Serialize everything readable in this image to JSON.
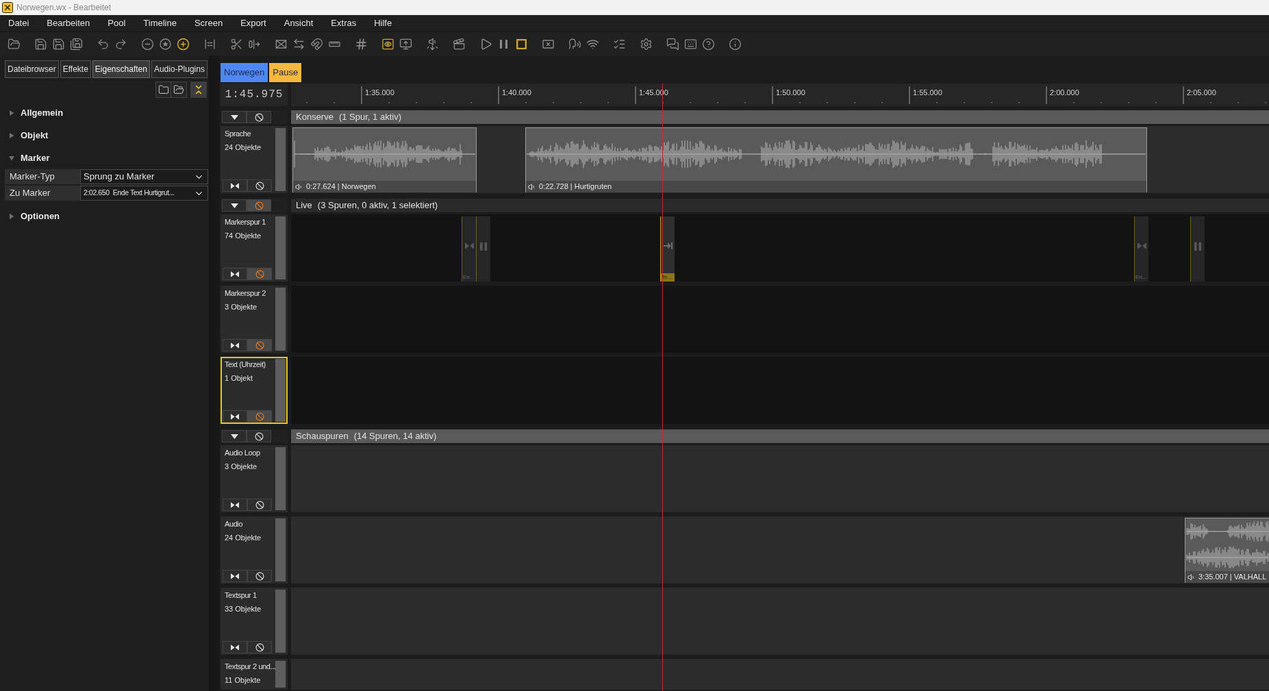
{
  "window": {
    "title": "Norwegen.wx - Bearbeitet"
  },
  "menu": [
    "Datei",
    "Bearbeiten",
    "Pool",
    "Timeline",
    "Screen",
    "Export",
    "Ansicht",
    "Extras",
    "Hilfe"
  ],
  "toolbar": {
    "groups": [
      {
        "buttons": [
          {
            "kind": "open",
            "on": false
          }
        ]
      },
      {
        "buttons": [
          {
            "kind": "save",
            "on": false
          },
          {
            "kind": "saveas",
            "on": false
          },
          {
            "kind": "saveplus",
            "on": false
          }
        ]
      },
      {
        "buttons": [
          {
            "kind": "undo",
            "on": false
          },
          {
            "kind": "redo",
            "on": false
          }
        ]
      },
      {
        "buttons": [
          {
            "kind": "zoomout",
            "on": false
          },
          {
            "kind": "zoomstar",
            "on": false
          },
          {
            "kind": "zoomin",
            "on": true
          }
        ]
      },
      {
        "buttons": [
          {
            "kind": "columns",
            "on": false
          }
        ]
      },
      {
        "buttons": [
          {
            "kind": "cut",
            "on": false
          },
          {
            "kind": "split",
            "on": false
          }
        ]
      },
      {
        "buttons": [
          {
            "kind": "crossfade",
            "on": false
          },
          {
            "kind": "swap",
            "on": false
          },
          {
            "kind": "magnet",
            "on": false
          },
          {
            "kind": "ruler",
            "on": false
          }
        ]
      },
      {
        "buttons": [
          {
            "kind": "grid",
            "on": false
          }
        ]
      },
      {
        "buttons": [
          {
            "kind": "preview",
            "on": true
          },
          {
            "kind": "screen",
            "on": false
          }
        ]
      },
      {
        "buttons": [
          {
            "kind": "audio",
            "on": false
          }
        ]
      },
      {
        "buttons": [
          {
            "kind": "scene",
            "on": false
          }
        ]
      },
      {
        "buttons": [
          {
            "kind": "play",
            "on": false
          },
          {
            "kind": "pause",
            "on": false
          },
          {
            "kind": "stop",
            "on": true
          }
        ]
      },
      {
        "buttons": [
          {
            "kind": "close",
            "on": false
          }
        ]
      },
      {
        "buttons": [
          {
            "kind": "voice",
            "on": false
          },
          {
            "kind": "wifi",
            "on": false
          }
        ]
      },
      {
        "buttons": [
          {
            "kind": "checklist",
            "on": false
          }
        ]
      },
      {
        "buttons": [
          {
            "kind": "settings",
            "on": false
          }
        ]
      },
      {
        "buttons": [
          {
            "kind": "chat",
            "on": false
          },
          {
            "kind": "keyboard",
            "on": false
          },
          {
            "kind": "help",
            "on": false
          }
        ]
      },
      {
        "buttons": [
          {
            "kind": "info",
            "on": false
          }
        ]
      }
    ]
  },
  "side_panel": {
    "tabs": [
      {
        "label": "Dateibrowser",
        "selected": false
      },
      {
        "label": "Effekte",
        "selected": false
      },
      {
        "label": "Eigenschaften",
        "selected": true
      },
      {
        "label": "Audio-Plugins",
        "selected": false
      }
    ],
    "sections": [
      {
        "title": "Allgemein",
        "expanded": false
      },
      {
        "title": "Objekt",
        "expanded": false
      },
      {
        "title": "Marker",
        "expanded": true,
        "properties": [
          {
            "label": "Marker-Typ",
            "value": "Sprung zu Marker"
          },
          {
            "label": "Zu Marker",
            "value": "2:02.650  Ende Text Hurtigrut..."
          }
        ]
      },
      {
        "title": "Optionen",
        "expanded": false
      }
    ]
  },
  "timeline": {
    "tabs": [
      {
        "label": "Norwegen",
        "color": "#4f87f6"
      },
      {
        "label": "Pause",
        "color": "#f6b83e"
      }
    ],
    "time": "1:45.975",
    "ruler": [
      "1:35.000",
      "1:40.000",
      "1:45.000",
      "1:50.000",
      "1:55.000",
      "2:00.000",
      "2:05.000"
    ],
    "groups": [
      {
        "name": "Konserve",
        "summary": "(1 Spur, 1 aktiv)",
        "expanded": true,
        "active": true,
        "tracks": [
          {
            "name": "Sprache",
            "count": "24 Objekte",
            "active": true,
            "selected": false,
            "clips": [
              {
                "kind": "mono",
                "label": "0:27.624 | Norwegen"
              },
              {
                "kind": "mono",
                "label": "0:22.728 | Hurtigruten"
              }
            ]
          }
        ]
      },
      {
        "name": "Live",
        "summary": "(3 Spuren, 0 aktiv, 1 selektiert)",
        "expanded": true,
        "active": false,
        "tracks": [
          {
            "name": "Markerspur 1",
            "count": "74 Objekte",
            "active": false,
            "selected": false,
            "markers": [
              {
                "kind": "jump",
                "label": "En...",
                "selected": false
              },
              {
                "kind": "pause",
                "selected": false
              },
              {
                "kind": "goto",
                "label": "Te...",
                "selected": true
              },
              {
                "kind": "jump",
                "label": "En...",
                "selected": false
              },
              {
                "kind": "pause",
                "selected": false
              }
            ]
          },
          {
            "name": "Markerspur 2",
            "count": "3 Objekte",
            "active": false,
            "selected": false
          },
          {
            "name": "Text (Uhrzeit)",
            "count": "1 Objekt",
            "active": false,
            "selected": true
          }
        ]
      },
      {
        "name": "Schauspuren",
        "summary": "(14 Spuren, 14 aktiv)",
        "expanded": true,
        "active": true,
        "tracks": [
          {
            "name": "Audio Loop",
            "count": "3 Objekte",
            "active": true,
            "selected": false
          },
          {
            "name": "Audio",
            "count": "24 Objekte",
            "active": true,
            "selected": false,
            "clips": [
              {
                "kind": "stereo",
                "label": "3:35.007 | VALHALL"
              }
            ]
          },
          {
            "name": "Textspur 1",
            "count": "33 Objekte",
            "active": true,
            "selected": false
          },
          {
            "name": "Textspur 2 und...",
            "count": "11 Objekte",
            "active": true,
            "selected": false
          }
        ]
      }
    ]
  }
}
